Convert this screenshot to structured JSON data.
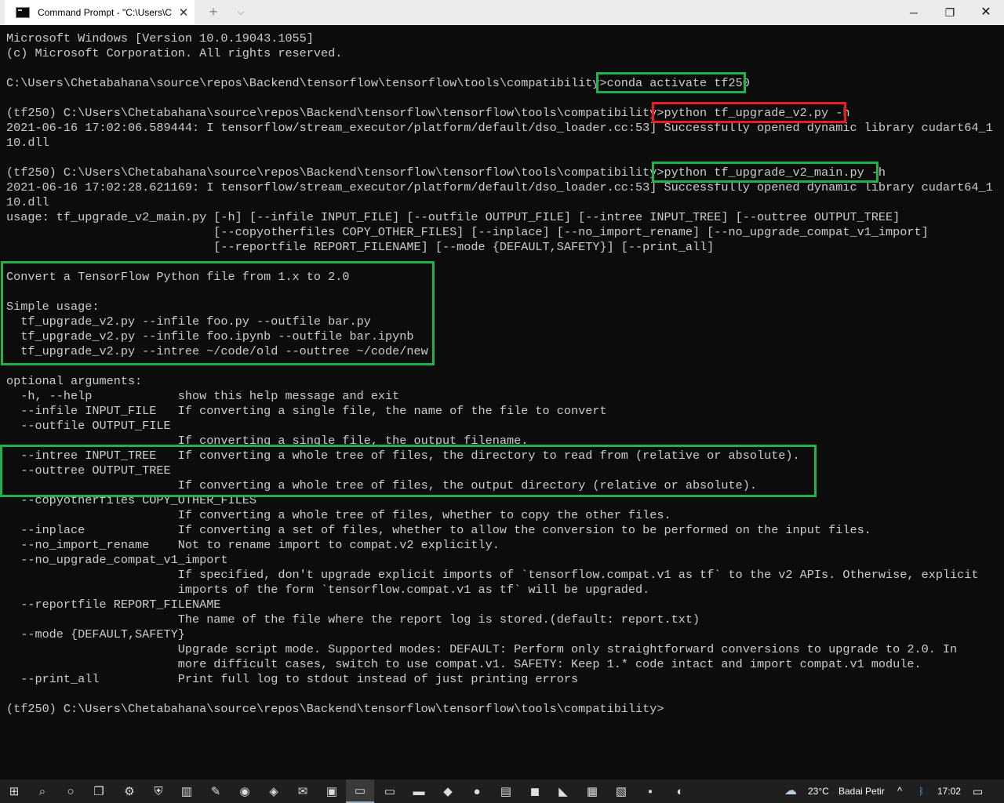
{
  "window": {
    "tab_title": "Command Prompt - \"C:\\Users\\C",
    "tab_close": "✕",
    "new_tab": "+",
    "tab_menu": "⌵",
    "minimize": "─",
    "restore": "❐",
    "close": "✕"
  },
  "console": {
    "lines": [
      "Microsoft Windows [Version 10.0.19043.1055]",
      "(c) Microsoft Corporation. All rights reserved.",
      "",
      "C:\\Users\\Chetabahana\\source\\repos\\Backend\\tensorflow\\tensorflow\\tools\\compatibility>conda activate tf250",
      "",
      "(tf250) C:\\Users\\Chetabahana\\source\\repos\\Backend\\tensorflow\\tensorflow\\tools\\compatibility>python tf_upgrade_v2.py -h",
      "2021-06-16 17:02:06.589444: I tensorflow/stream_executor/platform/default/dso_loader.cc:53] Successfully opened dynamic library cudart64_1",
      "10.dll",
      "",
      "(tf250) C:\\Users\\Chetabahana\\source\\repos\\Backend\\tensorflow\\tensorflow\\tools\\compatibility>python tf_upgrade_v2_main.py -h",
      "2021-06-16 17:02:28.621169: I tensorflow/stream_executor/platform/default/dso_loader.cc:53] Successfully opened dynamic library cudart64_1",
      "10.dll",
      "usage: tf_upgrade_v2_main.py [-h] [--infile INPUT_FILE] [--outfile OUTPUT_FILE] [--intree INPUT_TREE] [--outtree OUTPUT_TREE]",
      "                             [--copyotherfiles COPY_OTHER_FILES] [--inplace] [--no_import_rename] [--no_upgrade_compat_v1_import]",
      "                             [--reportfile REPORT_FILENAME] [--mode {DEFAULT,SAFETY}] [--print_all]",
      "",
      "Convert a TensorFlow Python file from 1.x to 2.0",
      "",
      "Simple usage:",
      "  tf_upgrade_v2.py --infile foo.py --outfile bar.py",
      "  tf_upgrade_v2.py --infile foo.ipynb --outfile bar.ipynb",
      "  tf_upgrade_v2.py --intree ~/code/old --outtree ~/code/new",
      "",
      "optional arguments:",
      "  -h, --help            show this help message and exit",
      "  --infile INPUT_FILE   If converting a single file, the name of the file to convert",
      "  --outfile OUTPUT_FILE",
      "                        If converting a single file, the output filename.",
      "  --intree INPUT_TREE   If converting a whole tree of files, the directory to read from (relative or absolute).",
      "  --outtree OUTPUT_TREE",
      "                        If converting a whole tree of files, the output directory (relative or absolute).",
      "  --copyotherfiles COPY_OTHER_FILES",
      "                        If converting a whole tree of files, whether to copy the other files.",
      "  --inplace             If converting a set of files, whether to allow the conversion to be performed on the input files.",
      "  --no_import_rename    Not to rename import to compat.v2 explicitly.",
      "  --no_upgrade_compat_v1_import",
      "                        If specified, don't upgrade explicit imports of `tensorflow.compat.v1 as tf` to the v2 APIs. Otherwise, explicit",
      "                        imports of the form `tensorflow.compat.v1 as tf` will be upgraded.",
      "  --reportfile REPORT_FILENAME",
      "                        The name of the file where the report log is stored.(default: report.txt)",
      "  --mode {DEFAULT,SAFETY}",
      "                        Upgrade script mode. Supported modes: DEFAULT: Perform only straightforward conversions to upgrade to 2.0. In",
      "                        more difficult cases, switch to use compat.v1. SAFETY: Keep 1.* code intact and import compat.v1 module.",
      "  --print_all           Print full log to stdout instead of just printing errors",
      "",
      "(tf250) C:\\Users\\Chetabahana\\source\\repos\\Backend\\tensorflow\\tensorflow\\tools\\compatibility>"
    ]
  },
  "annotation_colors": {
    "green": "#22b14c",
    "red": "#ed1c24"
  },
  "taskbar": {
    "items": [
      {
        "name": "windows-start-icon",
        "glyph": "⊞"
      },
      {
        "name": "search-icon",
        "glyph": "⌕"
      },
      {
        "name": "cortana-icon",
        "glyph": "○"
      },
      {
        "name": "task-view-icon",
        "glyph": "❐"
      },
      {
        "name": "settings-gear-icon",
        "glyph": "⚙"
      },
      {
        "name": "security-shield-icon",
        "glyph": "⛨"
      },
      {
        "name": "app-icon-1",
        "glyph": "▥"
      },
      {
        "name": "app-icon-2",
        "glyph": "✎"
      },
      {
        "name": "github-icon",
        "glyph": "◉"
      },
      {
        "name": "app-icon-3",
        "glyph": "◈"
      },
      {
        "name": "mail-icon",
        "glyph": "✉"
      },
      {
        "name": "app-icon-4",
        "glyph": "▣"
      },
      {
        "name": "command-prompt-icon",
        "glyph": "▭"
      },
      {
        "name": "terminal-icon",
        "glyph": "▭"
      },
      {
        "name": "file-explorer-icon",
        "glyph": "▬"
      },
      {
        "name": "git-icon",
        "glyph": "◆"
      },
      {
        "name": "app-icon-5",
        "glyph": "●"
      },
      {
        "name": "app-icon-6",
        "glyph": "▤"
      },
      {
        "name": "store-icon",
        "glyph": "◼"
      },
      {
        "name": "visual-studio-icon",
        "glyph": "◣"
      },
      {
        "name": "app-icon-7",
        "glyph": "▦"
      },
      {
        "name": "notepad-icon",
        "glyph": "▧"
      },
      {
        "name": "pycharm-icon",
        "glyph": "▪"
      },
      {
        "name": "edge-icon",
        "glyph": "◐"
      }
    ],
    "weather_icon": "☁",
    "temperature": "23°C",
    "weather_text": "Badai Petir",
    "tray_chevron": "^",
    "bluetooth_icon": "ᛒ",
    "clock": "17:02",
    "notification_icon": "▭"
  }
}
